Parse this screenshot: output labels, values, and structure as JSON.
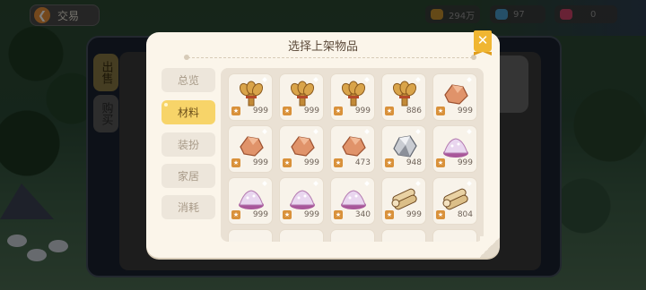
{
  "top_bar": {
    "trade_label": "交易",
    "currencies": [
      {
        "icon": "coin-icon",
        "value": "294万",
        "color": "#c8932f"
      },
      {
        "icon": "gem-icon",
        "value": "97",
        "color": "#4a9fd0"
      },
      {
        "icon": "candy-icon",
        "value": "0",
        "color": "#d0456b"
      }
    ]
  },
  "trade_window": {
    "tabs": [
      "出售",
      "购买"
    ]
  },
  "modal": {
    "title": "选择上架物品",
    "close_symbol": "✕",
    "categories": [
      {
        "label": "总览",
        "active": false
      },
      {
        "label": "材料",
        "active": true
      },
      {
        "label": "装扮",
        "active": false
      },
      {
        "label": "家居",
        "active": false
      },
      {
        "label": "消耗",
        "active": false
      }
    ],
    "items": [
      {
        "type": "wheat",
        "count": "999"
      },
      {
        "type": "wheat",
        "count": "999"
      },
      {
        "type": "wheat",
        "count": "999"
      },
      {
        "type": "wheat",
        "count": "886"
      },
      {
        "type": "copper",
        "count": "999"
      },
      {
        "type": "copper",
        "count": "999"
      },
      {
        "type": "copper",
        "count": "999"
      },
      {
        "type": "copper",
        "count": "473"
      },
      {
        "type": "silver",
        "count": "948"
      },
      {
        "type": "crystal",
        "count": "999"
      },
      {
        "type": "crystal",
        "count": "999"
      },
      {
        "type": "crystal",
        "count": "999"
      },
      {
        "type": "crystal",
        "count": "340"
      },
      {
        "type": "wood",
        "count": "999"
      },
      {
        "type": "wood",
        "count": "804"
      }
    ]
  }
}
